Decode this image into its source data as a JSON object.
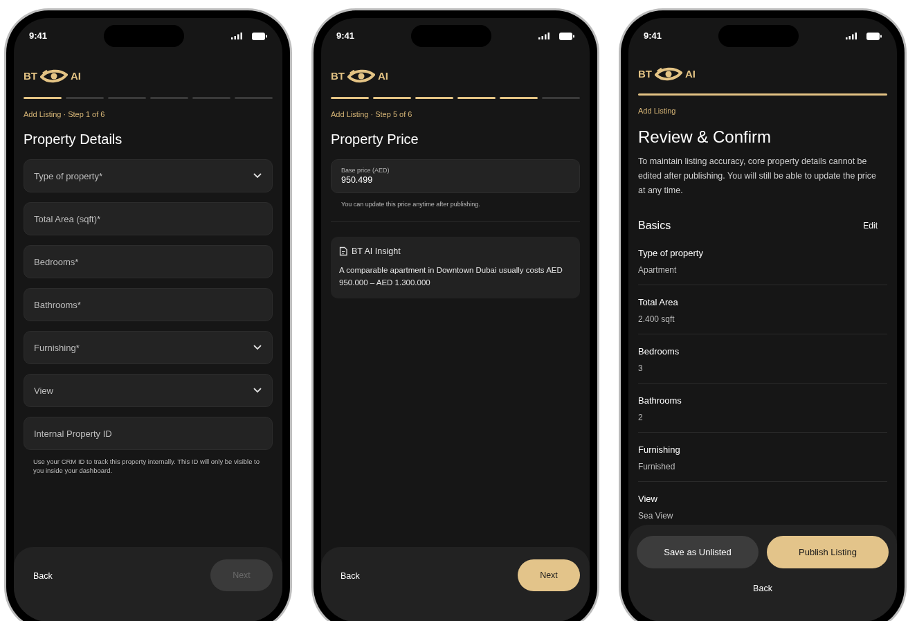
{
  "phones": [
    {
      "kind": "form",
      "time": "9:41",
      "logo": {
        "left": "BT",
        "right": "AI"
      },
      "progress": [
        {
          "done": true
        },
        {
          "done": false
        },
        {
          "done": false
        },
        {
          "done": false
        },
        {
          "done": false
        },
        {
          "done": false
        }
      ],
      "eyebrow": "Add Listing · Step 1 of 6",
      "title": "Property Details",
      "fields": [
        {
          "placeholder": "Type of property*",
          "dropdown": true
        },
        {
          "placeholder": "Total Area (sqft)*",
          "dropdown": false
        },
        {
          "placeholder": "Bedrooms*",
          "dropdown": false
        },
        {
          "placeholder": "Bathrooms*",
          "dropdown": false
        },
        {
          "placeholder": "Furnishing*",
          "dropdown": true
        },
        {
          "placeholder": "View",
          "dropdown": true
        },
        {
          "placeholder": "Internal Property ID",
          "dropdown": false
        }
      ],
      "helper": "Use your CRM ID to track this property internally. This ID will only be visible to you inside your dashboard.",
      "footer": {
        "back": "Back",
        "next": {
          "label": "Next",
          "disabled": true
        }
      }
    },
    {
      "kind": "price",
      "time": "9:41",
      "logo": {
        "left": "BT",
        "right": "AI"
      },
      "progress": [
        {
          "done": true
        },
        {
          "done": true
        },
        {
          "done": true
        },
        {
          "done": true
        },
        {
          "done": true
        },
        {
          "done": false
        }
      ],
      "eyebrow": "Add Listing · Step 5 of 6",
      "title": "Property Price",
      "price": {
        "label": "Base price (AED)",
        "value": "950.499"
      },
      "helper": "You can update this price anytime after publishing.",
      "insight": {
        "title": "BT AI Insight",
        "text": "A comparable apartment in Downtown Dubai usually costs AED 950.000 – AED 1.300.000"
      },
      "footer": {
        "back": "Back",
        "next": {
          "label": "Next",
          "disabled": false
        }
      }
    },
    {
      "kind": "review",
      "time": "9:41",
      "logo": {
        "left": "BT",
        "right": "AI"
      },
      "progress": [
        {
          "done": true
        }
      ],
      "eyebrow": "Add Listing",
      "title": "Review & Confirm",
      "description": "To maintain listing accuracy, core property details cannot be edited after publishing. You will still be able to update the price at any time.",
      "section": {
        "title": "Basics",
        "action": "Edit"
      },
      "items": [
        {
          "label": "Type of property",
          "value": "Apartment"
        },
        {
          "label": "Total Area",
          "value": "2.400 sqft"
        },
        {
          "label": "Bedrooms",
          "value": "3"
        },
        {
          "label": "Bathrooms",
          "value": "2"
        },
        {
          "label": "Furnishing",
          "value": "Furnished"
        },
        {
          "label": "View",
          "value": "Sea View"
        }
      ],
      "actions": {
        "secondary": "Save as Unlisted",
        "primary": "Publish Listing",
        "back": "Back"
      }
    }
  ]
}
